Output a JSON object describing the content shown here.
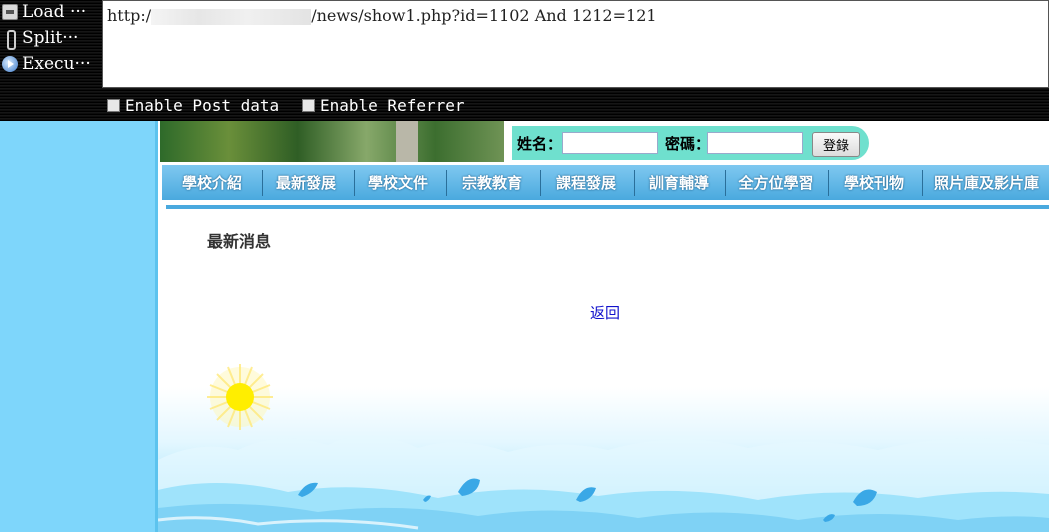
{
  "hackbar": {
    "load_label": "Load ···",
    "split_label": "Split···",
    "execute_label": "Execu···",
    "url_prefix": "http:/",
    "url_suffix": "/news/show1.php?id=1102 And 1212=121",
    "enable_post_label": "Enable Post data",
    "enable_referrer_label": "Enable Referrer"
  },
  "login": {
    "name_label": "姓名：",
    "password_label": "密碼：",
    "submit_label": "登錄"
  },
  "nav": {
    "items": [
      "學校介紹",
      "最新發展",
      "學校文件",
      "宗教教育",
      "課程發展",
      "訓育輔導",
      "全方位學習",
      "學校刊物",
      "照片庫及影片庫"
    ]
  },
  "main": {
    "section_title": "最新消息",
    "back_link": "返回"
  },
  "colors": {
    "left_panel": "#7ed6fb",
    "nav_bar": "#4aa9de",
    "login_bar": "#6fe0ce",
    "link": "#1111cc"
  }
}
